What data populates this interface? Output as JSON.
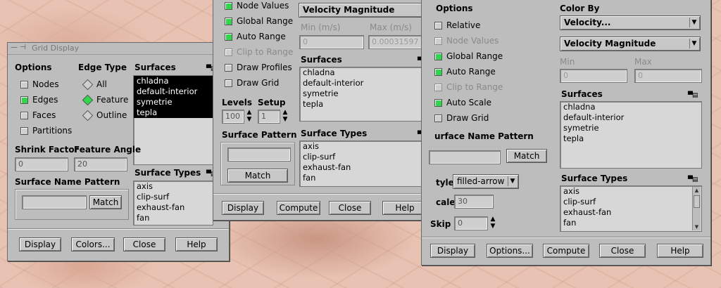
{
  "grid_display": {
    "title": "Grid Display",
    "options_header": "Options",
    "options": [
      {
        "label": "Nodes",
        "checked": false
      },
      {
        "label": "Edges",
        "checked": true
      },
      {
        "label": "Faces",
        "checked": false
      },
      {
        "label": "Partitions",
        "checked": false
      }
    ],
    "edge_type_header": "Edge Type",
    "edge_types": [
      {
        "label": "All",
        "selected": false
      },
      {
        "label": "Feature",
        "selected": true
      },
      {
        "label": "Outline",
        "selected": false
      }
    ],
    "surfaces_header": "Surfaces",
    "surfaces": [
      "chladna",
      "default-interior",
      "symetrie",
      "tepla"
    ],
    "shrink_factor_label": "Shrink Factor",
    "shrink_factor_value": "0",
    "feature_angle_label": "Feature Angle",
    "feature_angle_value": "20",
    "surface_name_pattern_label": "Surface Name Pattern",
    "match_label": "Match",
    "surface_types_header": "Surface Types",
    "surface_types": [
      "axis",
      "clip-surf",
      "exhaust-fan",
      "fan"
    ],
    "buttons": {
      "display": "Display",
      "colors": "Colors...",
      "close": "Close",
      "help": "Help"
    }
  },
  "contours": {
    "options": [
      {
        "label": "Node Values",
        "checked": true,
        "enabled": true
      },
      {
        "label": "Global Range",
        "checked": true,
        "enabled": true
      },
      {
        "label": "Auto Range",
        "checked": true,
        "enabled": true
      },
      {
        "label": "Clip to Range",
        "checked": false,
        "enabled": false
      },
      {
        "label": "Draw Profiles",
        "checked": false,
        "enabled": true
      },
      {
        "label": "Draw Grid",
        "checked": false,
        "enabled": true
      }
    ],
    "variable": "Velocity Magnitude",
    "min_label": "Min (m/s)",
    "min_value": "0",
    "max_label": "Max (m/s)",
    "max_value": "0.00031597",
    "surfaces_header": "Surfaces",
    "surfaces": [
      "chladna",
      "default-interior",
      "symetrie",
      "tepla"
    ],
    "levels_label": "Levels",
    "levels_value": "100",
    "setup_label": "Setup",
    "setup_value": "1",
    "surface_pattern_label": "Surface Pattern",
    "match_label": "Match",
    "surface_types_header": "Surface Types",
    "surface_types": [
      "axis",
      "clip-surf",
      "exhaust-fan",
      "fan"
    ],
    "buttons": {
      "display": "Display",
      "compute": "Compute",
      "close": "Close",
      "help": "Help"
    }
  },
  "vectors": {
    "options_header": "Options",
    "options": [
      {
        "label": "Relative",
        "checked": false,
        "enabled": true
      },
      {
        "label": "Node Values",
        "checked": false,
        "enabled": false
      },
      {
        "label": "Global Range",
        "checked": true,
        "enabled": true
      },
      {
        "label": "Auto Range",
        "checked": true,
        "enabled": true
      },
      {
        "label": "Clip to Range",
        "checked": false,
        "enabled": false
      },
      {
        "label": "Auto Scale",
        "checked": true,
        "enabled": true
      },
      {
        "label": "Draw Grid",
        "checked": false,
        "enabled": true
      }
    ],
    "color_by_label": "Color By",
    "color_by_category": "Velocity...",
    "color_by_variable": "Velocity Magnitude",
    "min_label": "Min",
    "min_value": "0",
    "max_label": "Max",
    "max_value": "0",
    "surfaces_header": "Surfaces",
    "surfaces": [
      "chladna",
      "default-interior",
      "symetrie",
      "tepla"
    ],
    "surface_name_pattern_label": "urface Name Pattern",
    "match_label": "Match",
    "style_label": "tyle",
    "style_value": "filled-arrow",
    "scale_label": "cale",
    "scale_value": "30",
    "skip_label": "Skip",
    "skip_value": "0",
    "surface_types_header": "Surface Types",
    "surface_types": [
      "axis",
      "clip-surf",
      "exhaust-fan",
      "fan"
    ],
    "buttons": {
      "display": "Display",
      "options": "Options...",
      "compute": "Compute",
      "close": "Close",
      "help": "Help"
    }
  }
}
